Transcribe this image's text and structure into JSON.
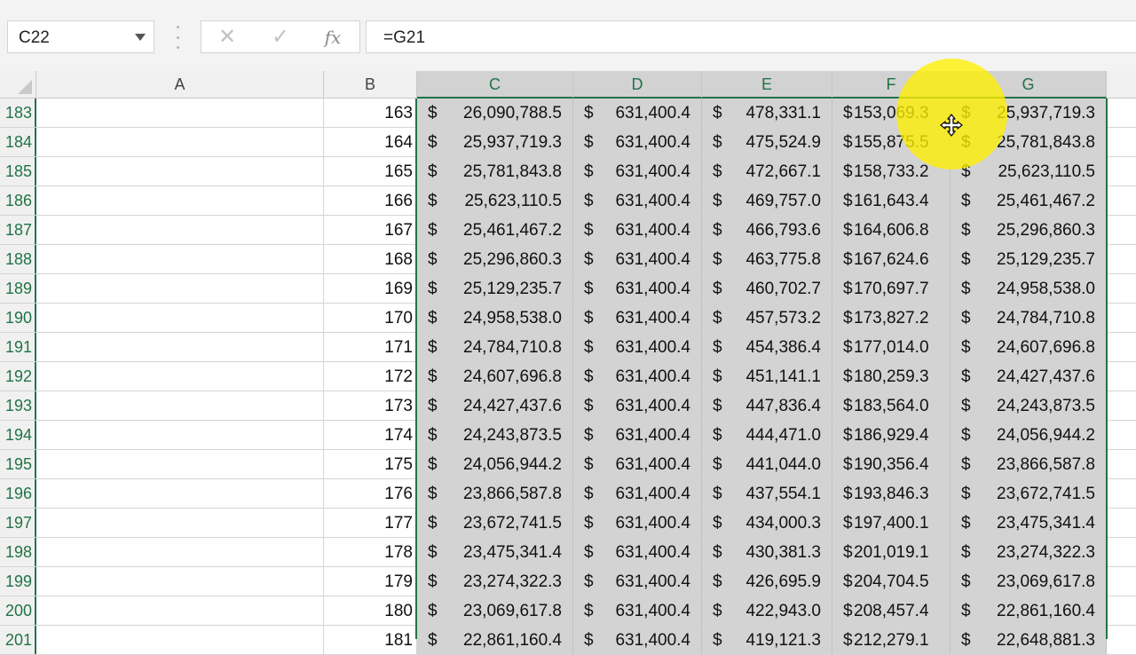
{
  "name_box": {
    "value": "C22"
  },
  "formula_bar": {
    "cancel_glyph": "✕",
    "enter_glyph": "✓",
    "fx_glyph": "fx",
    "formula": "=G21"
  },
  "columns": [
    "A",
    "B",
    "C",
    "D",
    "E",
    "F",
    "G"
  ],
  "selected_columns": [
    "C",
    "D",
    "E",
    "F",
    "G"
  ],
  "currency_symbol": "$",
  "rows": [
    {
      "row": "183",
      "b": "163",
      "c": "26,090,788.5",
      "d": "631,400.4",
      "e": "478,331.1",
      "f": "153,069.3",
      "g": "25,937,719.3"
    },
    {
      "row": "184",
      "b": "164",
      "c": "25,937,719.3",
      "d": "631,400.4",
      "e": "475,524.9",
      "f": "155,875.5",
      "g": "25,781,843.8"
    },
    {
      "row": "185",
      "b": "165",
      "c": "25,781,843.8",
      "d": "631,400.4",
      "e": "472,667.1",
      "f": "158,733.2",
      "g": "25,623,110.5"
    },
    {
      "row": "186",
      "b": "166",
      "c": "25,623,110.5",
      "d": "631,400.4",
      "e": "469,757.0",
      "f": "161,643.4",
      "g": "25,461,467.2"
    },
    {
      "row": "187",
      "b": "167",
      "c": "25,461,467.2",
      "d": "631,400.4",
      "e": "466,793.6",
      "f": "164,606.8",
      "g": "25,296,860.3"
    },
    {
      "row": "188",
      "b": "168",
      "c": "25,296,860.3",
      "d": "631,400.4",
      "e": "463,775.8",
      "f": "167,624.6",
      "g": "25,129,235.7"
    },
    {
      "row": "189",
      "b": "169",
      "c": "25,129,235.7",
      "d": "631,400.4",
      "e": "460,702.7",
      "f": "170,697.7",
      "g": "24,958,538.0"
    },
    {
      "row": "190",
      "b": "170",
      "c": "24,958,538.0",
      "d": "631,400.4",
      "e": "457,573.2",
      "f": "173,827.2",
      "g": "24,784,710.8"
    },
    {
      "row": "191",
      "b": "171",
      "c": "24,784,710.8",
      "d": "631,400.4",
      "e": "454,386.4",
      "f": "177,014.0",
      "g": "24,607,696.8"
    },
    {
      "row": "192",
      "b": "172",
      "c": "24,607,696.8",
      "d": "631,400.4",
      "e": "451,141.1",
      "f": "180,259.3",
      "g": "24,427,437.6"
    },
    {
      "row": "193",
      "b": "173",
      "c": "24,427,437.6",
      "d": "631,400.4",
      "e": "447,836.4",
      "f": "183,564.0",
      "g": "24,243,873.5"
    },
    {
      "row": "194",
      "b": "174",
      "c": "24,243,873.5",
      "d": "631,400.4",
      "e": "444,471.0",
      "f": "186,929.4",
      "g": "24,056,944.2"
    },
    {
      "row": "195",
      "b": "175",
      "c": "24,056,944.2",
      "d": "631,400.4",
      "e": "441,044.0",
      "f": "190,356.4",
      "g": "23,866,587.8"
    },
    {
      "row": "196",
      "b": "176",
      "c": "23,866,587.8",
      "d": "631,400.4",
      "e": "437,554.1",
      "f": "193,846.3",
      "g": "23,672,741.5"
    },
    {
      "row": "197",
      "b": "177",
      "c": "23,672,741.5",
      "d": "631,400.4",
      "e": "434,000.3",
      "f": "197,400.1",
      "g": "23,475,341.4"
    },
    {
      "row": "198",
      "b": "178",
      "c": "23,475,341.4",
      "d": "631,400.4",
      "e": "430,381.3",
      "f": "201,019.1",
      "g": "23,274,322.3"
    },
    {
      "row": "199",
      "b": "179",
      "c": "23,274,322.3",
      "d": "631,400.4",
      "e": "426,695.9",
      "f": "204,704.5",
      "g": "23,069,617.8"
    },
    {
      "row": "200",
      "b": "180",
      "c": "23,069,617.8",
      "d": "631,400.4",
      "e": "422,943.0",
      "f": "208,457.4",
      "g": "22,861,160.4"
    },
    {
      "row": "201",
      "b": "181",
      "c": "22,861,160.4",
      "d": "631,400.4",
      "e": "419,121.3",
      "f": "212,279.1",
      "g": "22,648,881.3"
    }
  ],
  "colors": {
    "accent": "#217346",
    "selection_fill": "#d3d3d3",
    "highlight": "#ffef00"
  },
  "icons": {
    "name_box_dropdown": "chevron-down-icon",
    "cancel": "close-icon",
    "enter": "check-icon",
    "insert_function": "fx-icon",
    "pointer": "move-cursor-icon"
  }
}
